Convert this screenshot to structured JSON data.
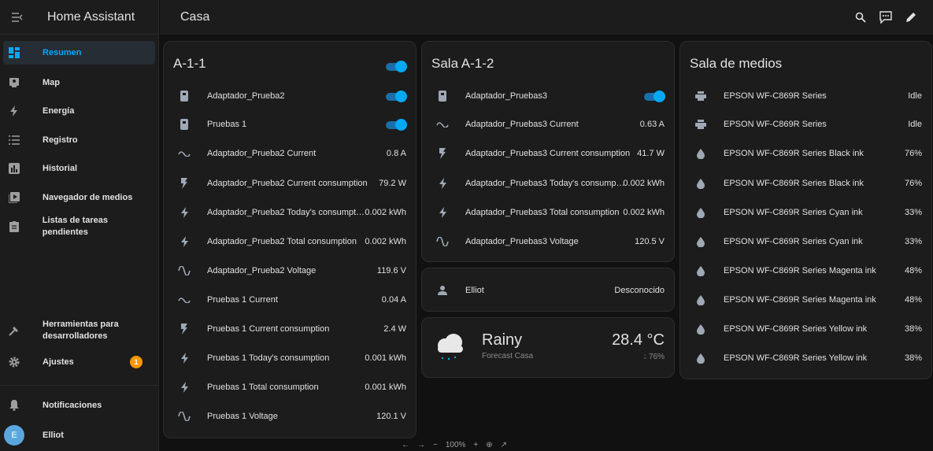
{
  "app": {
    "title": "Home Assistant"
  },
  "sidebar": {
    "items": [
      {
        "label": "Resumen",
        "icon": "dashboard-icon",
        "active": true
      },
      {
        "label": "Map",
        "icon": "map-icon"
      },
      {
        "label": "Energía",
        "icon": "lightning-bolt-icon"
      },
      {
        "label": "Registro",
        "icon": "list-icon"
      },
      {
        "label": "Historial",
        "icon": "chart-box-icon"
      },
      {
        "label": "Navegador de medios",
        "icon": "play-box-icon"
      },
      {
        "label": "Listas de tareas pendientes",
        "icon": "clipboard-list-icon"
      }
    ],
    "bottom": [
      {
        "label": "Herramientas para desarrolladores",
        "icon": "hammer-icon"
      },
      {
        "label": "Ajustes",
        "icon": "cog-icon",
        "badge": "1"
      },
      {
        "label": "Notificaciones",
        "icon": "bell-icon"
      },
      {
        "label": "Elliot",
        "avatar": "E"
      }
    ]
  },
  "header": {
    "title": "Casa",
    "icons": [
      "search-icon",
      "assist-icon",
      "pencil-icon"
    ]
  },
  "cards": {
    "a11": {
      "title": "A-1-1",
      "header_toggle": "on",
      "rows": [
        {
          "name": "Adaptador_Prueba2",
          "icon": "plug-icon",
          "toggle": "on"
        },
        {
          "name": "Pruebas 1",
          "icon": "plug-icon",
          "toggle": "on"
        },
        {
          "name": "Adaptador_Prueba2 Current",
          "value": "0.8 A",
          "icon": "current-ac-icon"
        },
        {
          "name": "Adaptador_Prueba2 Current consumption",
          "value": "79.2 W",
          "icon": "flash-icon"
        },
        {
          "name": "Adaptador_Prueba2 Today's consumpt…",
          "value": "0.002 kWh",
          "icon": "lightning-icon"
        },
        {
          "name": "Adaptador_Prueba2 Total consumption",
          "value": "0.002 kWh",
          "icon": "lightning-icon"
        },
        {
          "name": "Adaptador_Prueba2 Voltage",
          "value": "119.6 V",
          "icon": "sine-wave-icon"
        },
        {
          "name": "Pruebas 1 Current",
          "value": "0.04 A",
          "icon": "current-ac-icon"
        },
        {
          "name": "Pruebas 1 Current consumption",
          "value": "2.4 W",
          "icon": "flash-icon"
        },
        {
          "name": "Pruebas 1 Today's consumption",
          "value": "0.001 kWh",
          "icon": "lightning-icon"
        },
        {
          "name": "Pruebas 1 Total consumption",
          "value": "0.001 kWh",
          "icon": "lightning-icon"
        },
        {
          "name": "Pruebas 1 Voltage",
          "value": "120.1 V",
          "icon": "sine-wave-icon"
        }
      ]
    },
    "a12": {
      "title": "Sala A-1-2",
      "rows": [
        {
          "name": "Adaptador_Pruebas3",
          "icon": "plug-icon",
          "toggle": "on"
        },
        {
          "name": "Adaptador_Pruebas3 Current",
          "value": "0.63 A",
          "icon": "current-ac-icon"
        },
        {
          "name": "Adaptador_Pruebas3 Current consumption",
          "value": "41.7 W",
          "icon": "flash-icon"
        },
        {
          "name": "Adaptador_Pruebas3 Today's consump…",
          "value": "0.002 kWh",
          "icon": "lightning-icon"
        },
        {
          "name": "Adaptador_Pruebas3 Total consumption",
          "value": "0.002 kWh",
          "icon": "lightning-icon"
        },
        {
          "name": "Adaptador_Pruebas3 Voltage",
          "value": "120.5 V",
          "icon": "sine-wave-icon"
        }
      ]
    },
    "person": {
      "name": "Elliot",
      "state": "Desconocido",
      "icon": "account-icon"
    },
    "weather": {
      "condition": "Rainy",
      "subtitle": "Forecast Casa",
      "temperature": "28.4 °C",
      "humidity": "76%",
      "icon": "rainy-cloud-icon"
    },
    "media": {
      "title": "Sala de medios",
      "rows": [
        {
          "name": "EPSON WF-C869R Series",
          "value": "Idle",
          "icon": "printer-icon"
        },
        {
          "name": "EPSON WF-C869R Series",
          "value": "Idle",
          "icon": "printer-icon"
        },
        {
          "name": "EPSON WF-C869R Series Black ink",
          "value": "76%",
          "icon": "water-drop-icon"
        },
        {
          "name": "EPSON WF-C869R Series Black ink",
          "value": "76%",
          "icon": "water-drop-icon"
        },
        {
          "name": "EPSON WF-C869R Series Cyan ink",
          "value": "33%",
          "icon": "water-drop-icon"
        },
        {
          "name": "EPSON WF-C869R Series Cyan ink",
          "value": "33%",
          "icon": "water-drop-icon"
        },
        {
          "name": "EPSON WF-C869R Series Magenta ink",
          "value": "48%",
          "icon": "water-drop-icon"
        },
        {
          "name": "EPSON WF-C869R Series Magenta ink",
          "value": "48%",
          "icon": "water-drop-icon"
        },
        {
          "name": "EPSON WF-C869R Series Yellow ink",
          "value": "38%",
          "icon": "water-drop-icon"
        },
        {
          "name": "EPSON WF-C869R Series Yellow ink",
          "value": "38%",
          "icon": "water-drop-icon"
        }
      ]
    }
  },
  "zoom": {
    "level": "100%"
  },
  "colors": {
    "accent": "#03a9f4",
    "badge": "#ff9800",
    "background": "#111111",
    "card": "#1c1c1c"
  }
}
